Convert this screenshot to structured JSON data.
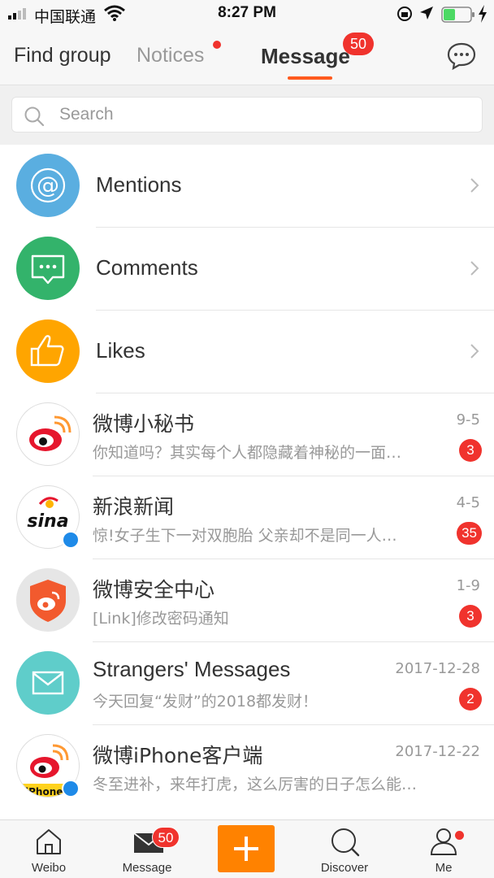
{
  "status_bar": {
    "carrier": "中国联通",
    "time": "8:27 PM"
  },
  "nav": {
    "tabs": [
      {
        "label": "Find group"
      },
      {
        "label": "Notices"
      },
      {
        "label": "Message",
        "badge": "50",
        "active": true
      }
    ]
  },
  "search": {
    "placeholder": "Search"
  },
  "categories": [
    {
      "label": "Mentions",
      "color": "#5aaee0"
    },
    {
      "label": "Comments",
      "color": "#33b36b"
    },
    {
      "label": "Likes",
      "color": "#ffa500"
    }
  ],
  "conversations": [
    {
      "name": "微博小秘书",
      "date": "9-5",
      "preview": "你知道吗？其实每个人都隐藏着神秘的一面…",
      "count": "3"
    },
    {
      "name": "新浪新闻",
      "date": "4-5",
      "preview": "惊!女子生下一对双胞胎 父亲却不是同一人…",
      "count": "35",
      "avatar_text": "sina"
    },
    {
      "name": "微博安全中心",
      "date": "1-9",
      "preview": "[Link]修改密码通知",
      "count": "3"
    },
    {
      "name": "Strangers' Messages",
      "date": "2017-12-28",
      "preview": "今天回复“发财”的2018都发财！",
      "count": "2"
    },
    {
      "name": "微博iPhone客户端",
      "date": "2017-12-22",
      "preview": "冬至进补，来年打虎，这么厉害的日子怎么能错过…",
      "avatar_text": "iPhone"
    }
  ],
  "tab_bar": {
    "items": [
      {
        "label": "Weibo"
      },
      {
        "label": "Message",
        "badge": "50"
      },
      {
        "label": ""
      },
      {
        "label": "Discover"
      },
      {
        "label": "Me"
      }
    ]
  },
  "colors": {
    "accent": "#ff5a1e",
    "badge": "#f0332d",
    "compose": "#ff8200"
  }
}
